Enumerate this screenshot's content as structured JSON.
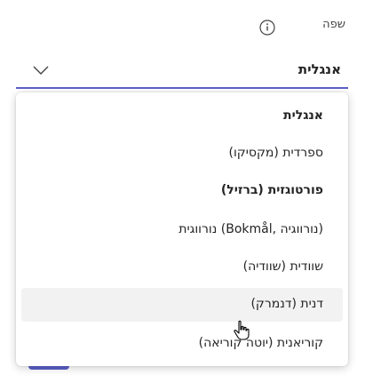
{
  "field": {
    "label": "שפה",
    "info_icon": "info-icon"
  },
  "select": {
    "value": "אנגלית",
    "chevron_icon": "chevron-down-icon"
  },
  "options": [
    {
      "label": "אנגלית",
      "selected": true
    },
    {
      "label": "ספרדית (מקסיקו)"
    },
    {
      "label": "פורטוגזית (ברזיל)",
      "bold": true
    },
    {
      "label": "נורווגית (Bokmål, נורווגיה)"
    },
    {
      "label": "שוודית (שוודיה)"
    },
    {
      "label": "דנית (דנמרק)",
      "hovered": true
    },
    {
      "label": "קוריאנית (יוטה קוריאה)"
    }
  ],
  "colors": {
    "accent": "#5b5fc7",
    "hover_bg": "#f2f2f2",
    "text": "#242424"
  },
  "cursor": "hand-pointer-icon"
}
